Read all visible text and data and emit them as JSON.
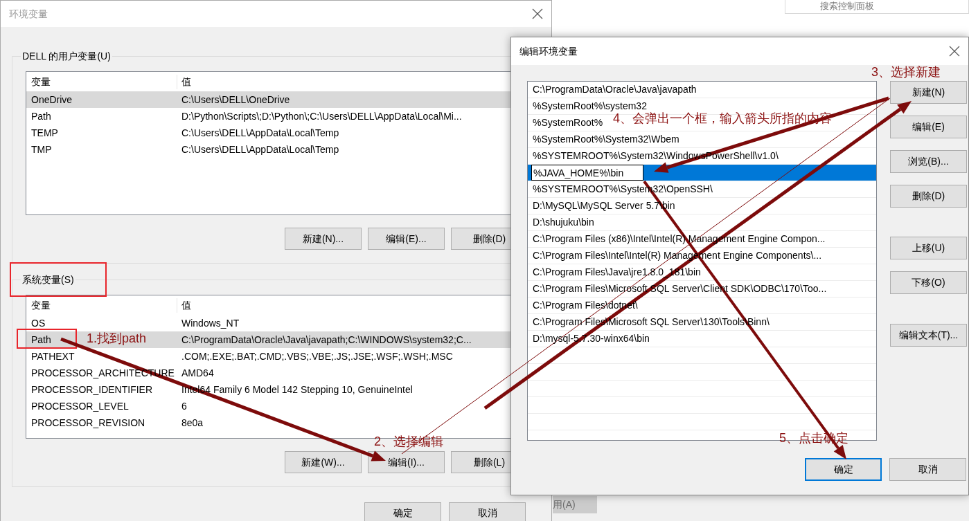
{
  "background": {
    "search": {
      "placeholder": "搜索控制面板"
    },
    "apply_button": "用(A)"
  },
  "env_dialog": {
    "title": "环境变量",
    "user_vars": {
      "label": "DELL 的用户变量(U)",
      "columns": [
        "变量",
        "值"
      ],
      "rows": [
        {
          "name": "OneDrive",
          "value": "C:\\Users\\DELL\\OneDrive",
          "selected": true
        },
        {
          "name": "Path",
          "value": "D:\\Python\\Scripts\\;D:\\Python\\;C:\\Users\\DELL\\AppData\\Local\\Mi...",
          "selected": false
        },
        {
          "name": "TEMP",
          "value": "C:\\Users\\DELL\\AppData\\Local\\Temp",
          "selected": false
        },
        {
          "name": "TMP",
          "value": "C:\\Users\\DELL\\AppData\\Local\\Temp",
          "selected": false
        }
      ],
      "buttons": [
        "新建(N)...",
        "编辑(E)...",
        "删除(D)"
      ]
    },
    "system_vars": {
      "label": "系统变量(S)",
      "columns": [
        "变量",
        "值"
      ],
      "rows": [
        {
          "name": "OS",
          "value": "Windows_NT",
          "selected": false
        },
        {
          "name": "Path",
          "value": "C:\\ProgramData\\Oracle\\Java\\javapath;C:\\WINDOWS\\system32;C...",
          "selected": true
        },
        {
          "name": "PATHEXT",
          "value": ".COM;.EXE;.BAT;.CMD;.VBS;.VBE;.JS;.JSE;.WSF;.WSH;.MSC",
          "selected": false
        },
        {
          "name": "PROCESSOR_ARCHITECTURE",
          "value": "AMD64",
          "selected": false
        },
        {
          "name": "PROCESSOR_IDENTIFIER",
          "value": "Intel64 Family 6 Model 142 Stepping 10, GenuineIntel",
          "selected": false
        },
        {
          "name": "PROCESSOR_LEVEL",
          "value": "6",
          "selected": false
        },
        {
          "name": "PROCESSOR_REVISION",
          "value": "8e0a",
          "selected": false
        }
      ],
      "buttons": [
        "新建(W)...",
        "编辑(I)...",
        "删除(L)"
      ]
    },
    "buttons": [
      "确定",
      "取消"
    ]
  },
  "edit_dialog": {
    "title": "编辑环境变量",
    "entries": [
      {
        "text": "C:\\ProgramData\\Oracle\\Java\\javapath",
        "selected": false,
        "editing": false
      },
      {
        "text": "%SystemRoot%\\system32",
        "selected": false,
        "editing": false
      },
      {
        "text": "%SystemRoot%",
        "selected": false,
        "editing": false
      },
      {
        "text": "%SystemRoot%\\System32\\Wbem",
        "selected": false,
        "editing": false
      },
      {
        "text": "%SYSTEMROOT%\\System32\\WindowsPowerShell\\v1.0\\",
        "selected": false,
        "editing": false
      },
      {
        "text": "%JAVA_HOME%\\bin",
        "selected": true,
        "editing": true
      },
      {
        "text": "%SYSTEMROOT%\\System32\\OpenSSH\\",
        "selected": false,
        "editing": false
      },
      {
        "text": "D:\\MySQL\\MySQL Server 5.7\\bin",
        "selected": false,
        "editing": false
      },
      {
        "text": "D:\\shujuku\\bin",
        "selected": false,
        "editing": false
      },
      {
        "text": "C:\\Program Files (x86)\\Intel\\Intel(R) Management Engine Compon...",
        "selected": false,
        "editing": false
      },
      {
        "text": "C:\\Program Files\\Intel\\Intel(R) Management Engine Components\\...",
        "selected": false,
        "editing": false
      },
      {
        "text": "C:\\Program Files\\Java\\jre1.8.0_181\\bin",
        "selected": false,
        "editing": false
      },
      {
        "text": "C:\\Program Files\\Microsoft SQL Server\\Client SDK\\ODBC\\170\\Too...",
        "selected": false,
        "editing": false
      },
      {
        "text": "C:\\Program Files\\dotnet\\",
        "selected": false,
        "editing": false
      },
      {
        "text": "C:\\Program Files\\Microsoft SQL Server\\130\\Tools\\Binn\\",
        "selected": false,
        "editing": false
      },
      {
        "text": "D:\\mysql-5.7.30-winx64\\bin",
        "selected": false,
        "editing": false
      }
    ],
    "button_groups": [
      [
        "新建(N)",
        "编辑(E)",
        "浏览(B)...",
        "删除(D)"
      ],
      [
        "上移(U)",
        "下移(O)"
      ],
      [
        "编辑文本(T)..."
      ]
    ],
    "buttons": [
      {
        "label": "确定",
        "default": true
      },
      {
        "label": "取消",
        "default": false
      }
    ]
  },
  "annotations": [
    {
      "text": "1.找到path"
    },
    {
      "text": "2、选择编辑"
    },
    {
      "text": "3、选择新建"
    },
    {
      "text": "4、会弹出一个框，输入箭头所指的内容"
    },
    {
      "text": "5、点击确定"
    }
  ]
}
